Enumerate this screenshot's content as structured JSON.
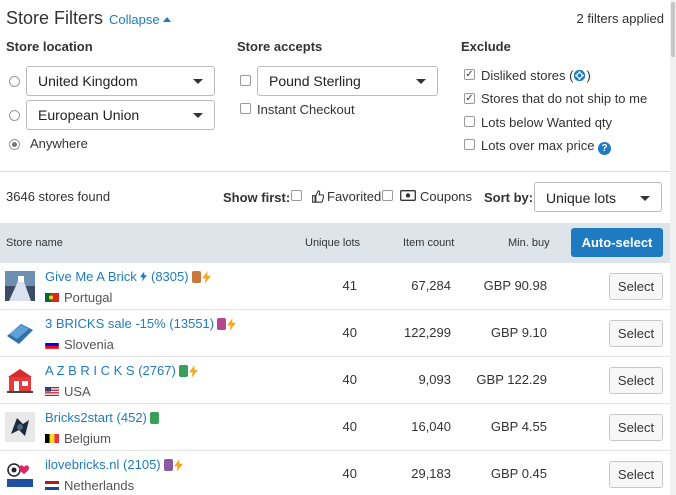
{
  "header": {
    "title": "Store Filters",
    "collapse_label": "Collapse",
    "filters_applied": "2 filters applied"
  },
  "store_location": {
    "title": "Store location",
    "options": [
      {
        "type": "select",
        "value": "United Kingdom",
        "selected": false
      },
      {
        "type": "select",
        "value": "European Union",
        "selected": false
      },
      {
        "type": "label",
        "value": "Anywhere",
        "selected": true
      }
    ]
  },
  "store_accepts": {
    "title": "Store accepts",
    "currency": {
      "value": "Pound Sterling",
      "checked": false
    },
    "instant_checkout": {
      "label": "Instant Checkout",
      "checked": false
    }
  },
  "exclude": {
    "title": "Exclude",
    "items": [
      {
        "label": "Disliked stores (",
        "suffix": ")",
        "checked": true,
        "icon": "gear-icon"
      },
      {
        "label": "Stores that do not ship to me",
        "checked": true
      },
      {
        "label": "Lots below Wanted qty",
        "checked": false
      },
      {
        "label": "Lots over max price",
        "checked": false,
        "icon": "help-icon"
      }
    ]
  },
  "toolbar": {
    "stores_found": "3646 stores found",
    "show_first_label": "Show first:",
    "favorited_label": "Favorited",
    "coupons_label": "Coupons",
    "sort_by_label": "Sort by:",
    "sort_value": "Unique lots"
  },
  "table": {
    "headers": {
      "store_name": "Store name",
      "unique_lots": "Unique lots",
      "item_count": "Item count",
      "min_buy": "Min. buy"
    },
    "auto_select_label": "Auto-select",
    "select_label": "Select",
    "rows": [
      {
        "name": "Give Me A Brick",
        "rating": "(8305)",
        "has_bolt_after_name": true,
        "badges": [
          "#c8783a"
        ],
        "bolt": true,
        "country": "Portugal",
        "flag": "portugal",
        "unique_lots": "41",
        "item_count": "67,284",
        "min_buy": "GBP 90.98"
      },
      {
        "name": "3 BRICKS sale -15%",
        "rating": "(13551)",
        "has_bolt_after_name": false,
        "badges": [
          "#b6468f"
        ],
        "bolt": true,
        "country": "Slovenia",
        "flag": "slovenia",
        "unique_lots": "40",
        "item_count": "122,299",
        "min_buy": "GBP 9.10"
      },
      {
        "name": "A Z B R I C K S",
        "rating": "(2767)",
        "has_bolt_after_name": false,
        "badges": [
          "#3a9e5a"
        ],
        "bolt": true,
        "country": "USA",
        "flag": "usa",
        "unique_lots": "40",
        "item_count": "9,093",
        "min_buy": "GBP 122.29"
      },
      {
        "name": "Bricks2start",
        "rating": "(452)",
        "has_bolt_after_name": false,
        "badges": [
          "#3a9e5a"
        ],
        "bolt": false,
        "country": "Belgium",
        "flag": "belgium",
        "unique_lots": "40",
        "item_count": "16,040",
        "min_buy": "GBP 4.55"
      },
      {
        "name": "ilovebricks.nl",
        "rating": "(2105)",
        "has_bolt_after_name": false,
        "badges": [
          "#8a5aa6"
        ],
        "bolt": true,
        "country": "Netherlands",
        "flag": "netherlands",
        "unique_lots": "40",
        "item_count": "29,183",
        "min_buy": "GBP 0.45"
      }
    ]
  },
  "colors": {
    "link": "#1f7bc1",
    "header_bg": "#dde4ea",
    "bolt": "#f5a623"
  }
}
